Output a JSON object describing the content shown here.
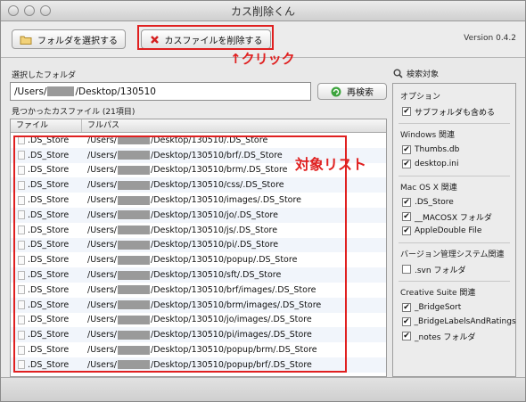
{
  "window": {
    "title": "カス削除くん"
  },
  "toolbar": {
    "select_folder_label": "フォルダを選択する",
    "delete_label": "カスファイルを削除する",
    "version": "Version 0.4.2"
  },
  "annotations": {
    "click_note": "↑クリック",
    "list_note": "対象リスト"
  },
  "folder": {
    "label": "選択したフォルダ",
    "path_prefix": "/Users/",
    "path_suffix": "/Desktop/130510",
    "rescan_label": "再検索"
  },
  "results": {
    "label": "見つかったカスファイル (21項目)",
    "columns": [
      "ファイル",
      "フルパス"
    ],
    "rows": [
      {
        "file": ".DS_Store",
        "path_prefix": "/Users/",
        "path_suffix": "/Desktop/130510/.DS_Store"
      },
      {
        "file": ".DS_Store",
        "path_prefix": "/Users/",
        "path_suffix": "/Desktop/130510/brf/.DS_Store"
      },
      {
        "file": ".DS_Store",
        "path_prefix": "/Users/",
        "path_suffix": "/Desktop/130510/brm/.DS_Store"
      },
      {
        "file": ".DS_Store",
        "path_prefix": "/Users/",
        "path_suffix": "/Desktop/130510/css/.DS_Store"
      },
      {
        "file": ".DS_Store",
        "path_prefix": "/Users/",
        "path_suffix": "/Desktop/130510/images/.DS_Store"
      },
      {
        "file": ".DS_Store",
        "path_prefix": "/Users/",
        "path_suffix": "/Desktop/130510/jo/.DS_Store"
      },
      {
        "file": ".DS_Store",
        "path_prefix": "/Users/",
        "path_suffix": "/Desktop/130510/js/.DS_Store"
      },
      {
        "file": ".DS_Store",
        "path_prefix": "/Users/",
        "path_suffix": "/Desktop/130510/pi/.DS_Store"
      },
      {
        "file": ".DS_Store",
        "path_prefix": "/Users/",
        "path_suffix": "/Desktop/130510/popup/.DS_Store"
      },
      {
        "file": ".DS_Store",
        "path_prefix": "/Users/",
        "path_suffix": "/Desktop/130510/sft/.DS_Store"
      },
      {
        "file": ".DS_Store",
        "path_prefix": "/Users/",
        "path_suffix": "/Desktop/130510/brf/images/.DS_Store"
      },
      {
        "file": ".DS_Store",
        "path_prefix": "/Users/",
        "path_suffix": "/Desktop/130510/brm/images/.DS_Store"
      },
      {
        "file": ".DS_Store",
        "path_prefix": "/Users/",
        "path_suffix": "/Desktop/130510/jo/images/.DS_Store"
      },
      {
        "file": ".DS_Store",
        "path_prefix": "/Users/",
        "path_suffix": "/Desktop/130510/pi/images/.DS_Store"
      },
      {
        "file": ".DS_Store",
        "path_prefix": "/Users/",
        "path_suffix": "/Desktop/130510/popup/brm/.DS_Store"
      },
      {
        "file": ".DS_Store",
        "path_prefix": "/Users/",
        "path_suffix": "/Desktop/130510/popup/brf/.DS_Store"
      }
    ]
  },
  "scope": {
    "label": "検索対象",
    "sections": [
      {
        "title": "オプション",
        "items": [
          {
            "label": "サブフォルダも含める",
            "checked": true
          }
        ]
      },
      {
        "title": "Windows 関連",
        "items": [
          {
            "label": "Thumbs.db",
            "checked": true
          },
          {
            "label": "desktop.ini",
            "checked": true
          }
        ]
      },
      {
        "title": "Mac OS X 関連",
        "items": [
          {
            "label": ".DS_Store",
            "checked": true
          },
          {
            "label": "__MACOSX フォルダ",
            "checked": true
          },
          {
            "label": "AppleDouble File",
            "checked": true
          }
        ]
      },
      {
        "title": "バージョン管理システム関連",
        "items": [
          {
            "label": ".svn フォルダ",
            "checked": false
          }
        ]
      },
      {
        "title": "Creative Suite 関連",
        "items": [
          {
            "label": "_BridgeSort",
            "checked": true
          },
          {
            "label": "_BridgeLabelsAndRatings",
            "checked": true
          },
          {
            "label": "_notes フォルダ",
            "checked": true
          }
        ]
      }
    ]
  },
  "colors": {
    "accent_red": "#e02020",
    "row_alt": "#f1f5fb"
  }
}
